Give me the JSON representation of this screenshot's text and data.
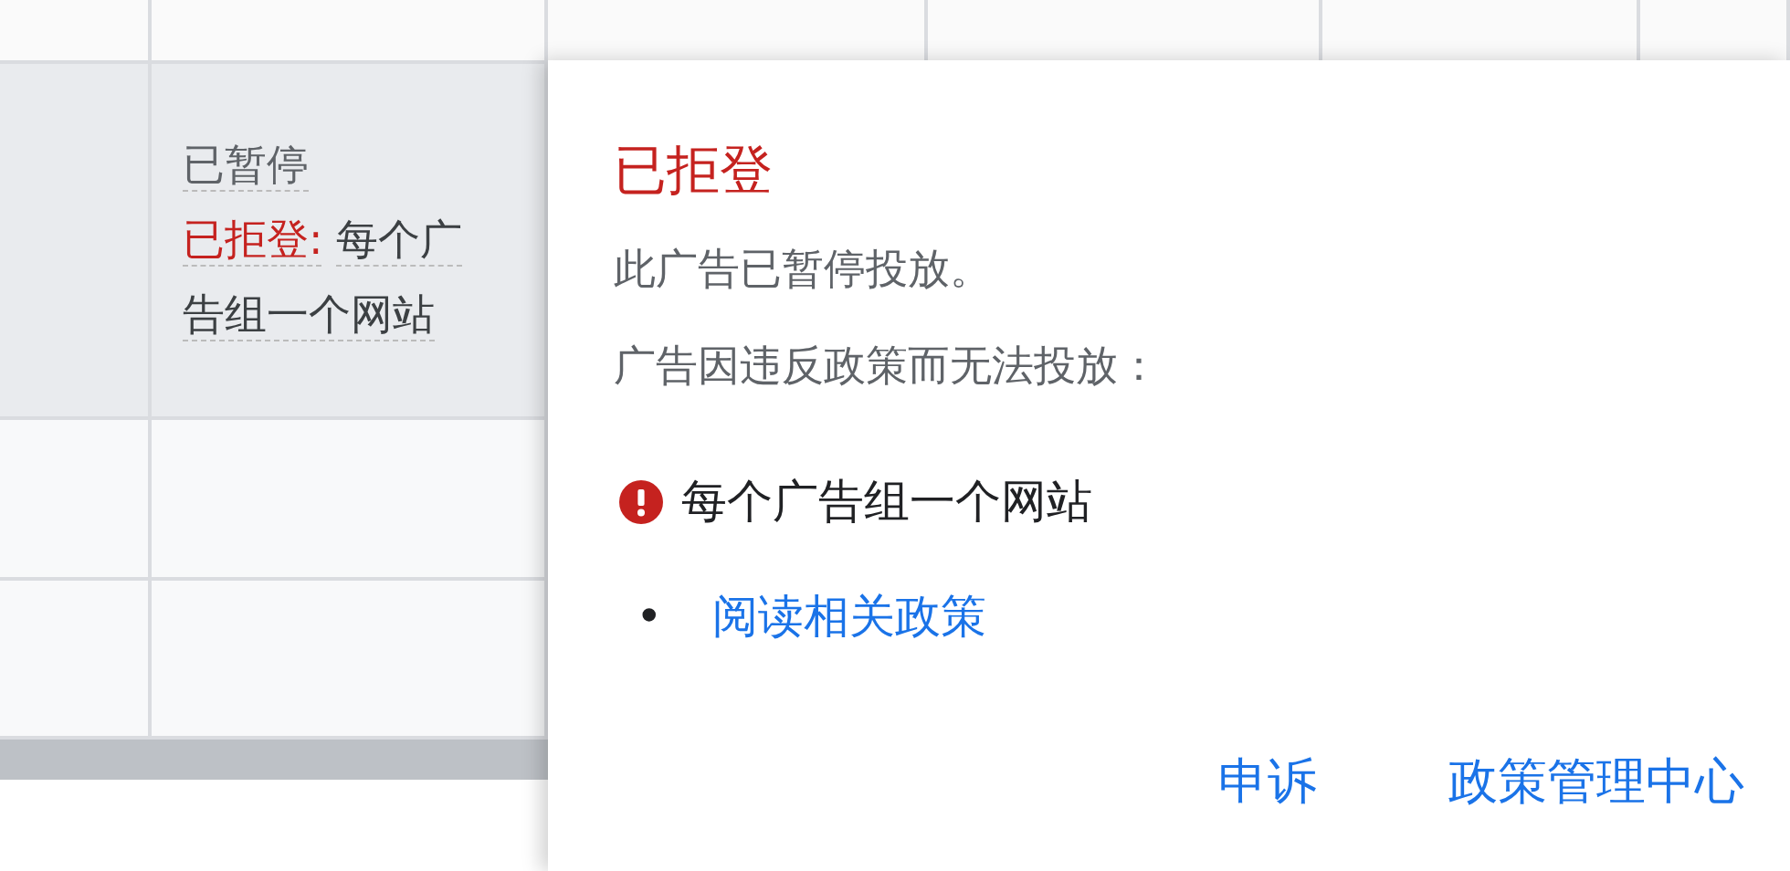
{
  "table": {
    "rows": [
      {
        "selected": true,
        "status": {
          "paused_label": "已暂停",
          "rejected_label": "已拒登:",
          "reason": "每个广告组一个网站"
        }
      },
      {
        "selected": false
      },
      {
        "selected": false
      }
    ]
  },
  "popup": {
    "title": "已拒登",
    "lines": [
      "此广告已暂停投放。",
      "广告因违反政策而无法投放："
    ],
    "violations": [
      {
        "text": "每个广告组一个网站",
        "links": [
          {
            "marker": "•",
            "text": "阅读相关政策"
          }
        ]
      }
    ],
    "actions": [
      "申诉",
      "政策管理中心"
    ]
  }
}
